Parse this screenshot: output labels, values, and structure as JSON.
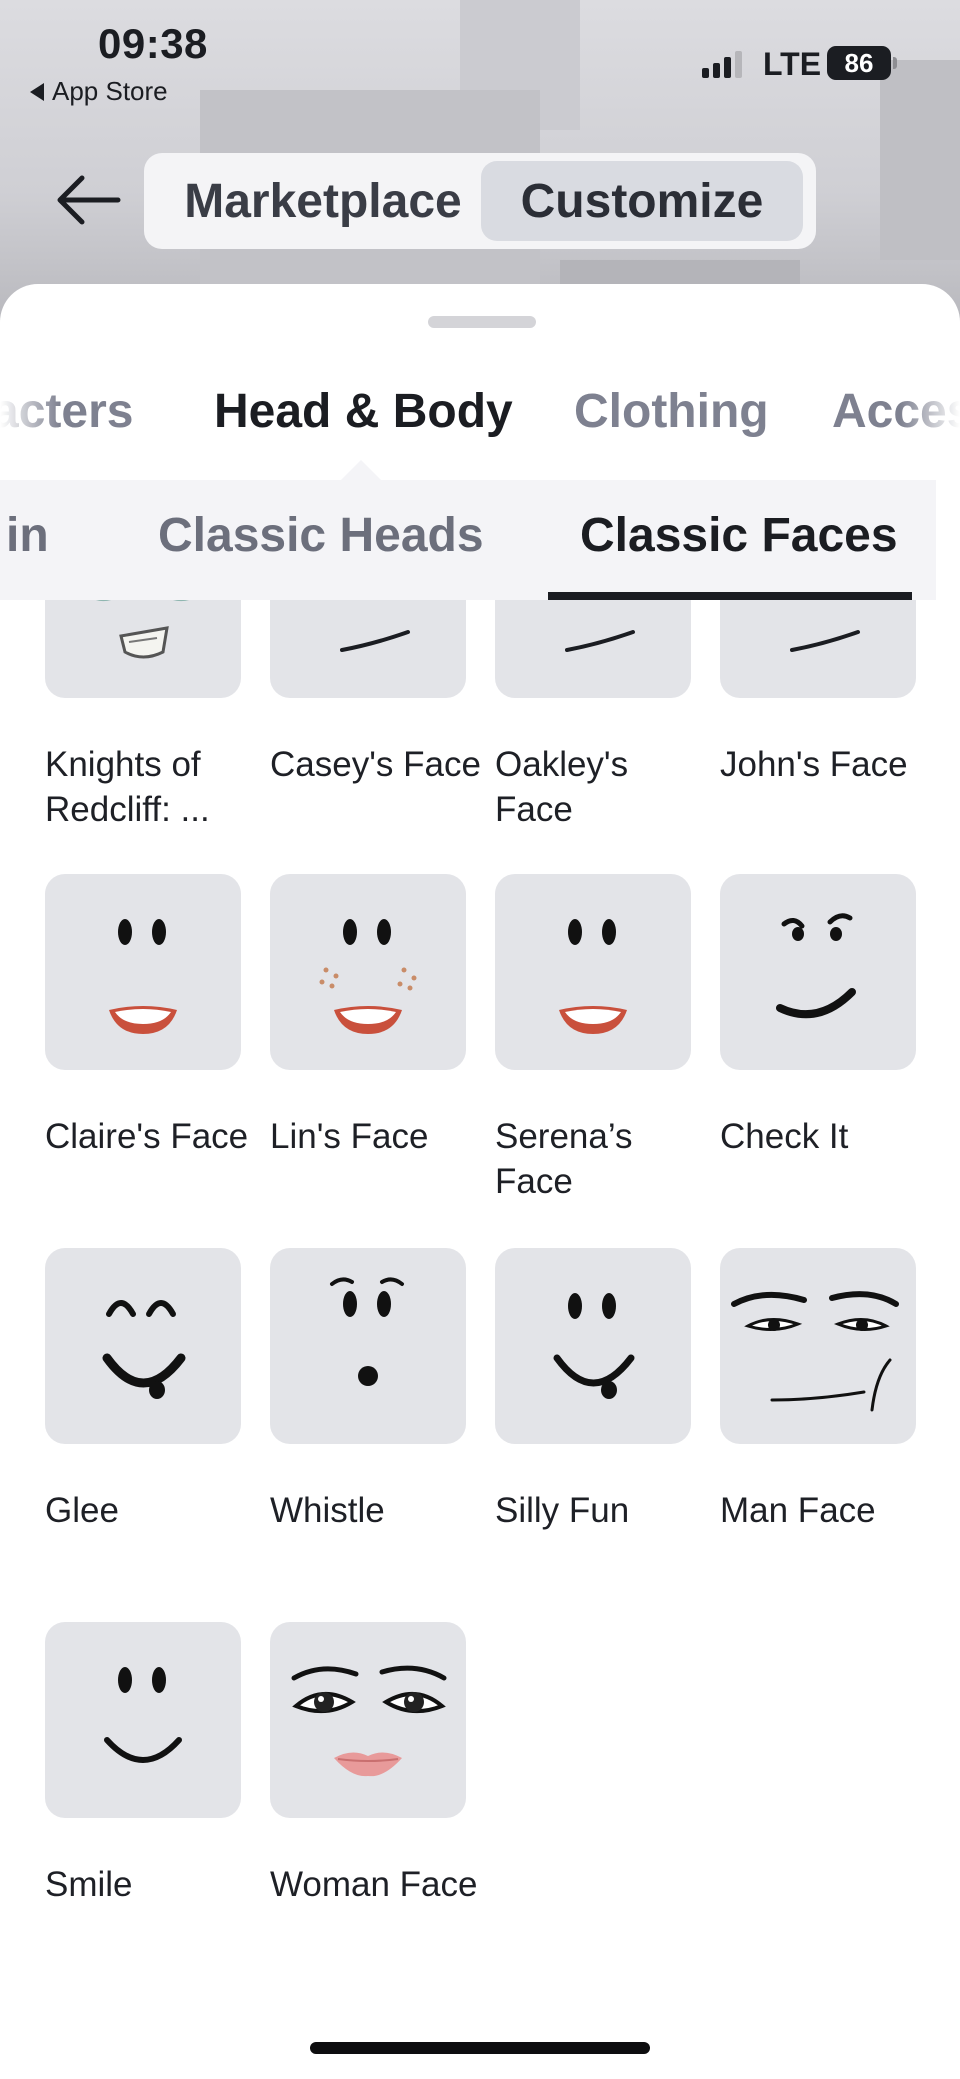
{
  "status_bar": {
    "time": "09:38",
    "back_app": "App Store",
    "network": "LTE",
    "battery": "86"
  },
  "top_nav": {
    "segments": [
      {
        "label": "Marketplace",
        "selected": false
      },
      {
        "label": "Customize",
        "selected": true
      }
    ]
  },
  "category_tabs": [
    {
      "label": "acters",
      "selected": false
    },
    {
      "label": "Head & Body",
      "selected": true
    },
    {
      "label": "Clothing",
      "selected": false
    },
    {
      "label": "Acces",
      "selected": false
    }
  ],
  "sub_tabs": [
    {
      "label": "in",
      "selected": false
    },
    {
      "label": "Classic Heads",
      "selected": false
    },
    {
      "label": "Classic Faces",
      "selected": true
    }
  ],
  "faces": [
    {
      "name": "Knights of Redcliff: ...",
      "icon": "knights-face-icon"
    },
    {
      "name": "Casey's Face",
      "icon": "smirk-face-icon"
    },
    {
      "name": "Oakley's Face",
      "icon": "smirk-face-icon"
    },
    {
      "name": "John's Face",
      "icon": "smirk-face-icon"
    },
    {
      "name": "Claire's Face",
      "icon": "lipstick-face-icon"
    },
    {
      "name": "Lin's Face",
      "icon": "freckles-face-icon"
    },
    {
      "name": "Serena’s Face",
      "icon": "lipstick-face-icon"
    },
    {
      "name": "Check It",
      "icon": "check-it-face-icon"
    },
    {
      "name": "Glee",
      "icon": "glee-face-icon"
    },
    {
      "name": "Whistle",
      "icon": "whistle-face-icon"
    },
    {
      "name": "Silly Fun",
      "icon": "silly-fun-face-icon"
    },
    {
      "name": "Man Face",
      "icon": "man-face-icon"
    },
    {
      "name": "Smile",
      "icon": "smile-face-icon"
    },
    {
      "name": "Woman Face",
      "icon": "woman-face-icon"
    }
  ],
  "colors": {
    "sheet": "#ffffff",
    "thumb": "#e3e4e8",
    "text_primary": "#1b1d22",
    "text_muted": "#7e8190",
    "lip_red": "#c9503c",
    "lip_pink": "#e89a9a"
  }
}
